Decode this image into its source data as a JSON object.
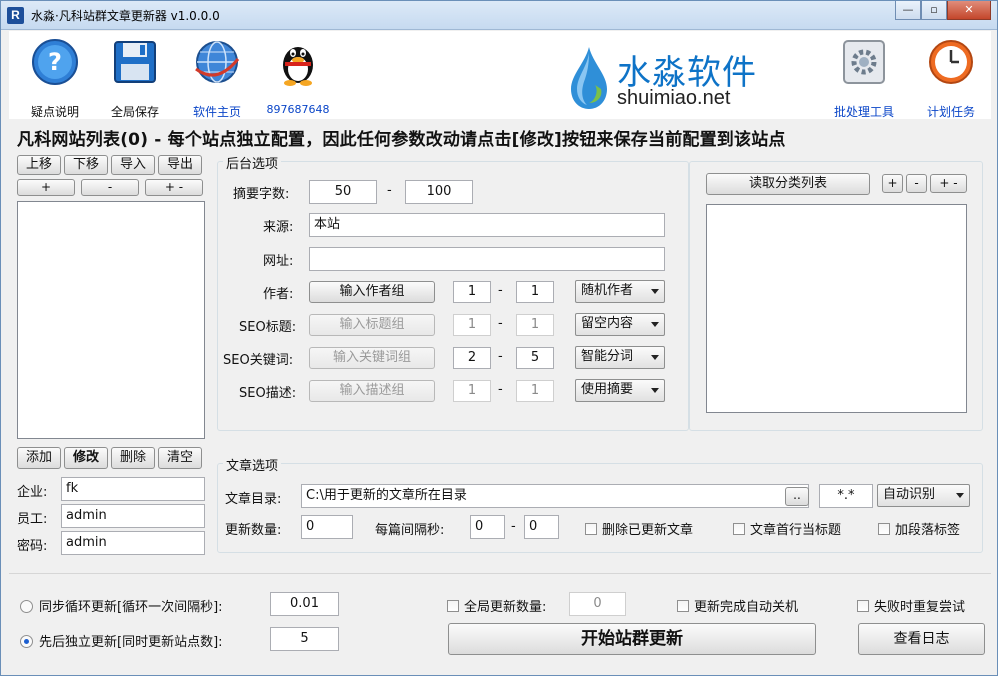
{
  "window": {
    "title": "水淼·凡科站群文章更新器 v1.0.0.0",
    "app_icon_letter": "R",
    "controls": {
      "minimize": "—",
      "maximize": "▫",
      "close": "✕"
    }
  },
  "toolbar": {
    "help_label": "疑点说明",
    "save_label": "全局保存",
    "home_label": "软件主页",
    "qq_label": "897687648",
    "batch_label": "批处理工具",
    "schedule_label": "计划任务"
  },
  "logo": {
    "cn": "水淼软件",
    "en": "shuimiao.net"
  },
  "headline": "凡科网站列表(0) - 每个站点独立配置，因此任何参数改动请点击[修改]按钮来保存当前配置到该站点",
  "site_list": {
    "move_up": "上移",
    "move_down": "下移",
    "import": "导入",
    "export": "导出",
    "add_sym": "+",
    "remove_sym": "-",
    "toggle_sym": "+ -",
    "add": "添加",
    "modify": "修改",
    "delete": "删除",
    "clear": "清空",
    "company_label": "企业:",
    "company_value": "fk",
    "employee_label": "员工:",
    "employee_value": "admin",
    "password_label": "密码:",
    "password_value": "admin"
  },
  "backend": {
    "title": "后台选项",
    "summary_label": "摘要字数:",
    "summary_min": "50",
    "summary_max": "100",
    "source_label": "来源:",
    "source_value": "本站",
    "url_label": "网址:",
    "url_value": "",
    "dash": "-",
    "rows": [
      {
        "label": "作者:",
        "button": "输入作者组",
        "min": "1",
        "max": "1",
        "select": "随机作者",
        "enabled": true
      },
      {
        "label": "SEO标题:",
        "button": "输入标题组",
        "min": "1",
        "max": "1",
        "select": "留空内容",
        "enabled": false
      },
      {
        "label": "SEO关键词:",
        "button": "输入关键词组",
        "min": "2",
        "max": "5",
        "select": "智能分词",
        "enabled": false
      },
      {
        "label": "SEO描述:",
        "button": "输入描述组",
        "min": "1",
        "max": "1",
        "select": "使用摘要",
        "enabled": false
      }
    ]
  },
  "category": {
    "read_button": "读取分类列表",
    "btn_add": "+",
    "btn_remove": "-",
    "btn_toggle": "+ -"
  },
  "article": {
    "title": "文章选项",
    "dir_label": "文章目录:",
    "dir_value": "C:\\用于更新的文章所在目录",
    "browse": "..",
    "ext_value": "*.*",
    "encoding": "自动识别",
    "count_label": "更新数量:",
    "count_value": "0",
    "interval_label": "每篇间隔秒:",
    "interval_min": "0",
    "interval_max": "0",
    "chk_delete": "删除已更新文章",
    "chk_first_line": "文章首行当标题",
    "chk_paragraph": "加段落标签"
  },
  "bottom": {
    "radio_sync": "同步循环更新[循环一次间隔秒]:",
    "sync_value": "0.01",
    "sync_selected": false,
    "radio_seq": "先后独立更新[同时更新站点数]:",
    "seq_value": "5",
    "seq_selected": true,
    "chk_global": "全局更新数量:",
    "global_value": "0",
    "chk_shutdown": "更新完成自动关机",
    "chk_retry": "失败时重复尝试",
    "start_button": "开始站群更新",
    "log_button": "查看日志"
  }
}
